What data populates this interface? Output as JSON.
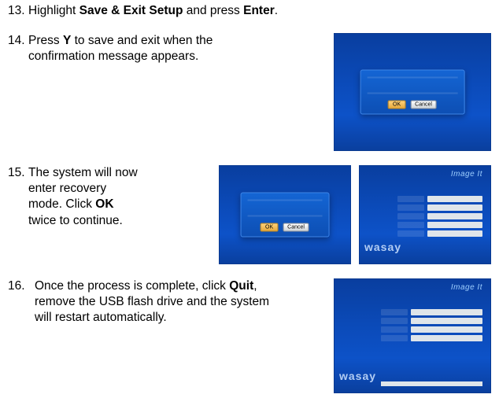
{
  "steps": {
    "s13": {
      "num": "13.",
      "pre": "Highlight ",
      "bold1": "Save & Exit Setup",
      "mid": " and press ",
      "bold2": "Enter",
      "post": "."
    },
    "s14": {
      "num": "14.",
      "pre": "Press ",
      "bold1": "Y",
      "post": " to save and exit when the confirmation message appears."
    },
    "s15": {
      "num": "15.",
      "pre": "The system will now enter recovery mode. Click ",
      "bold1": "OK",
      "post": " twice to continue."
    },
    "s16": {
      "num": "16.",
      "pre": "Once the pro­cess is complete, click ",
      "bold1": "Quit",
      "post": ", remove the USB flash drive and the system will restart automatically."
    }
  },
  "fig14": {
    "btn_ok": "OK",
    "btn_cancel": "Cancel"
  },
  "fig15a": {
    "btn_ok": "OK",
    "btn_cancel": "Cancel"
  },
  "fig_brand_top": "Image It",
  "fig_brand_left": "wasay"
}
